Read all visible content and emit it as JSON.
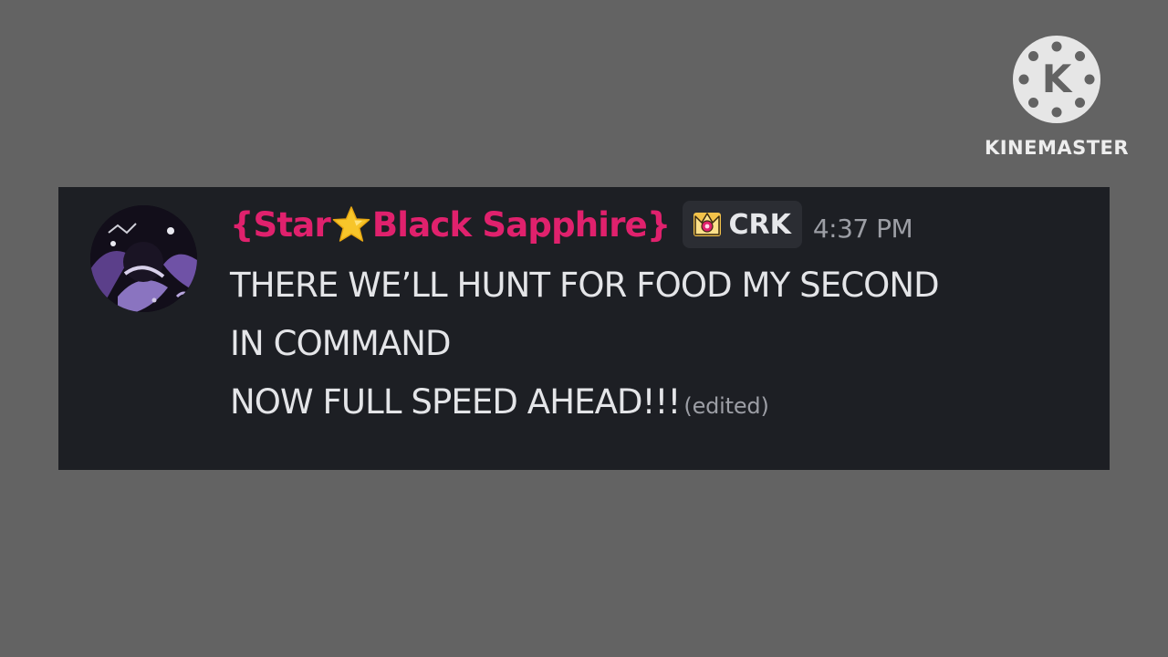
{
  "watermark": {
    "logo_letter": "K",
    "text": "KINEMASTER"
  },
  "message": {
    "avatar_icon": "user-avatar",
    "username_prefix": "{Star",
    "username_emoji": "star-icon",
    "username_suffix": "Black Sapphire}",
    "username_color": "#e0216d",
    "role_icon": "crown-icon",
    "role_label": "CRK",
    "timestamp": "4:37 PM",
    "lines": [
      "THERE WE’LL HUNT FOR FOOD MY SECOND",
      "IN COMMAND",
      "NOW FULL SPEED AHEAD!!!"
    ],
    "edited_label": "(edited)"
  },
  "colors": {
    "background": "#636363",
    "card": "#1d1f24",
    "text": "#e4e5e8",
    "muted": "#9c9ea5"
  }
}
